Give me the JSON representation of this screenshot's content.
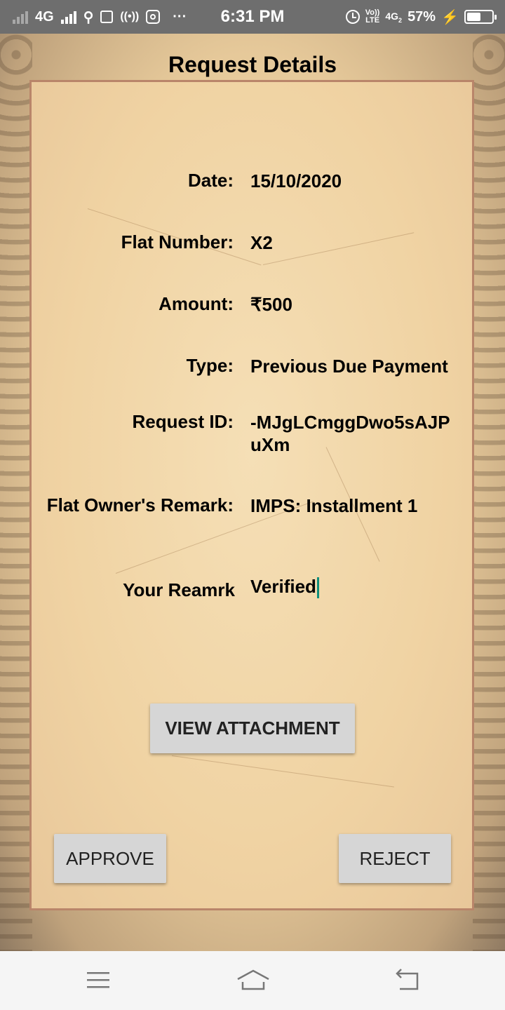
{
  "status_bar": {
    "network": "4G",
    "time": "6:31 PM",
    "volte_top": "Vo))",
    "volte_bottom": "LTE",
    "network2": "4G",
    "network2_sub": "2",
    "battery": "57%",
    "battery_level": 0.57
  },
  "page": {
    "title": "Request Details"
  },
  "details": [
    {
      "label": "Date:",
      "value": "15/10/2020"
    },
    {
      "label": "Flat Number:",
      "value": "X2"
    },
    {
      "label": "Amount:",
      "value": "₹500"
    },
    {
      "label": "Type:",
      "value": "Previous Due Payment"
    },
    {
      "label": "Request ID:",
      "value": "-MJgLCmggDwo5sAJPuXm"
    },
    {
      "label": "Flat Owner's Remark:",
      "value": "IMPS: Installment 1"
    }
  ],
  "remark": {
    "label": "Your Reamrk",
    "value": "Verified"
  },
  "buttons": {
    "view_attachment": "VIEW ATTACHMENT",
    "approve": "APPROVE",
    "reject": "REJECT"
  },
  "nav_bar": {
    "icons": [
      "menu-icon",
      "home-icon",
      "back-icon"
    ]
  }
}
